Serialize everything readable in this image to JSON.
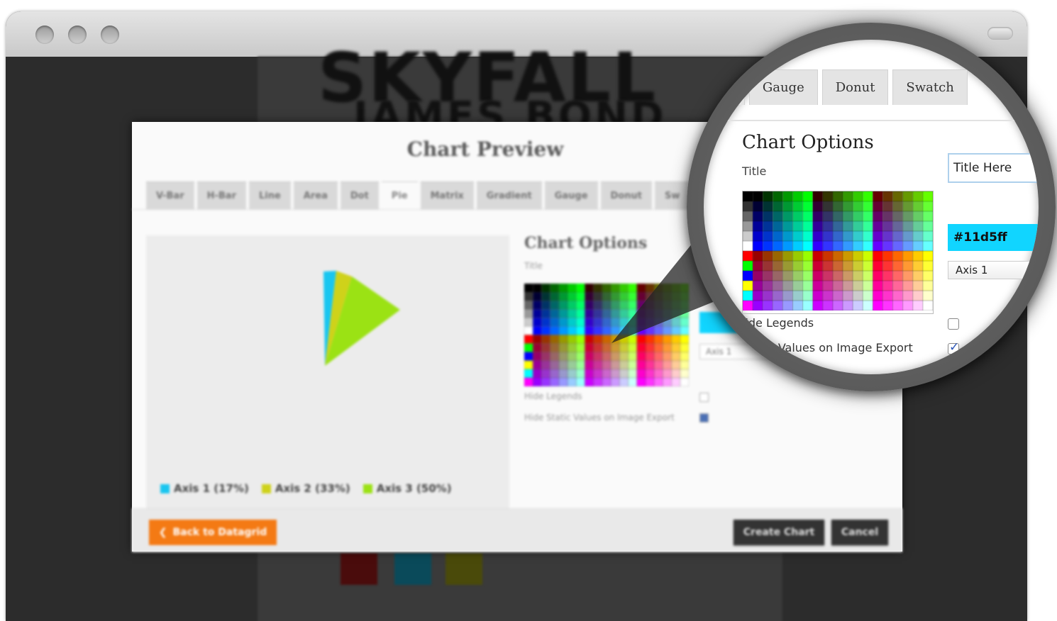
{
  "background_page": {
    "heading": "SKYFALL",
    "subheading": "JAMES BOND"
  },
  "modal": {
    "title": "Chart Preview",
    "tabs": [
      {
        "label": "V-Bar"
      },
      {
        "label": "H-Bar"
      },
      {
        "label": "Line"
      },
      {
        "label": "Area"
      },
      {
        "label": "Dot"
      },
      {
        "label": "Pie",
        "active": true
      },
      {
        "label": "Matrix"
      },
      {
        "label": "Gradient"
      },
      {
        "label": "Gauge"
      },
      {
        "label": "Donut"
      },
      {
        "label": "Sw"
      }
    ],
    "chart": {
      "legend": [
        {
          "label": "Axis 1 (17%)",
          "color": "#19c6f0"
        },
        {
          "label": "Axis 2 (33%)",
          "color": "#cfd21a"
        },
        {
          "label": "Axis 3 (50%)",
          "color": "#9be214"
        }
      ]
    },
    "options": {
      "heading": "Chart Options",
      "title_label": "Title",
      "hide_legends_label": "Hide Legends",
      "hide_static_label": "Hide Static Values on Image Export",
      "axis_select": "Axis 1"
    },
    "footer": {
      "back_label": "Back to Datagrid",
      "create_label": "Create Chart",
      "cancel_label": "Cancel"
    }
  },
  "zoom": {
    "tabs": [
      {
        "label": "rt"
      },
      {
        "label": "Gauge"
      },
      {
        "label": "Donut"
      },
      {
        "label": "Swatch"
      }
    ],
    "heading": "Chart Options",
    "title_label": "Title",
    "title_value": "Title Here",
    "color_value": "#11d5ff",
    "axis_select": "Axis 1",
    "hide_legends_label": "lide Legends",
    "hide_legends_checked": false,
    "hide_static_label": "Static Values on Image Export",
    "hide_static_checked": true
  }
}
